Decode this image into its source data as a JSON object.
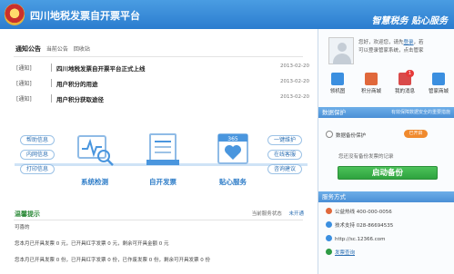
{
  "header": {
    "title": "四川地税发票自开票平台",
    "slogan": "智慧税务 贴心服务"
  },
  "notice": {
    "title": "通知公告",
    "tabs": [
      "当前公告",
      "回收站"
    ],
    "items": [
      {
        "tag": "[通知]",
        "text": "四川地税发票自开票平台正式上线",
        "date": "2013-02-20"
      },
      {
        "tag": "[通知]",
        "text": "用户积分的用途",
        "date": "2013-02-20"
      },
      {
        "tag": "[通知]",
        "text": "用户积分获取途径",
        "date": "2013-02-20"
      }
    ]
  },
  "features": {
    "left_pills": [
      "帮助信息",
      "内网信息",
      "打印信息"
    ],
    "right_pills": [
      "一键维护",
      "在线客服",
      "咨询建议"
    ],
    "cards": [
      "系统检测",
      "自开发票",
      "贴心服务"
    ],
    "calendar_number": "365"
  },
  "tips": {
    "title": "温馨提示",
    "status_label": "当前服务状态",
    "status_value": "未开通",
    "lines": [
      "可喜的",
      "您本月已开具发票 0 元，已开具红字发票 0 元，剩余可开具金额 0 元",
      "您本月已开具发票 0 份，已开具红字发票 0 份，已作废发票 0 份，剩余可开具发票 0 份"
    ]
  },
  "user": {
    "greeting_prefix": "您好，欢迎您，请先",
    "login_link": "登录",
    "greeting_mid": "，若",
    "greeting_line2": "可以登录管家系统，点击管家"
  },
  "quick": [
    {
      "label": "领机图",
      "color": "#3b8fe0"
    },
    {
      "label": "积分商城",
      "color": "#e0683b"
    },
    {
      "label": "我的消息",
      "color": "#d94a4a",
      "badge": "1"
    },
    {
      "label": "管家商城",
      "color": "#3b8fe0"
    }
  ],
  "backup": {
    "title": "数据保护",
    "subtitle": "有效保障数据安全的重要措施",
    "toggle_label": "数据备份保护",
    "toggle_state": "已开启",
    "note": "您还没有备份发票的记录",
    "button": "启动备份"
  },
  "service": {
    "title": "服务方式",
    "rows": [
      {
        "label": "公益热线",
        "value": "400-000-0056",
        "color": "#e0683b"
      },
      {
        "label": "技术支持",
        "value": "028-86694535",
        "color": "#3b8fe0"
      },
      {
        "label": "http://sc.12366.com",
        "value": "",
        "color": "#3b8fe0"
      },
      {
        "label": "发票查询",
        "value": "",
        "color": "#2e9b45",
        "link": true
      }
    ]
  }
}
